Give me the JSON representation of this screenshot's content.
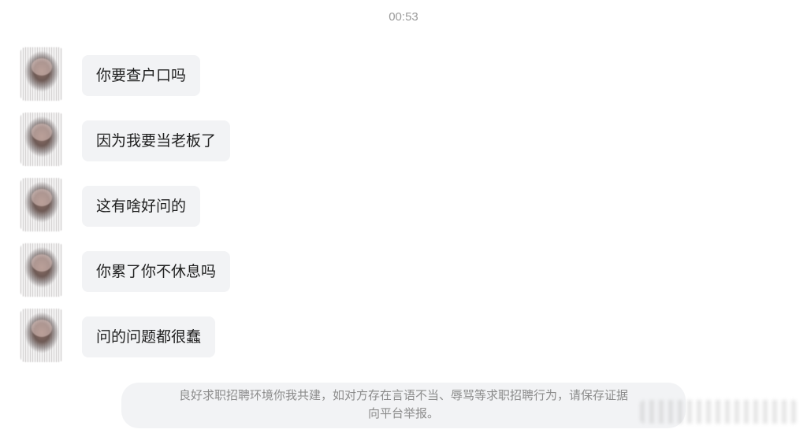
{
  "chat": {
    "timestamp": "00:53",
    "messages": [
      {
        "text": "你要查户口吗"
      },
      {
        "text": "因为我要当老板了"
      },
      {
        "text": "这有啥好问的"
      },
      {
        "text": "你累了你不休息吗"
      },
      {
        "text": "问的问题都很蠢"
      }
    ],
    "notice": {
      "line1": "良好求职招聘环境你我共建，如对方存在言语不当、辱骂等求职招聘行为，请保存证据",
      "line2": "向平台举报。"
    }
  }
}
